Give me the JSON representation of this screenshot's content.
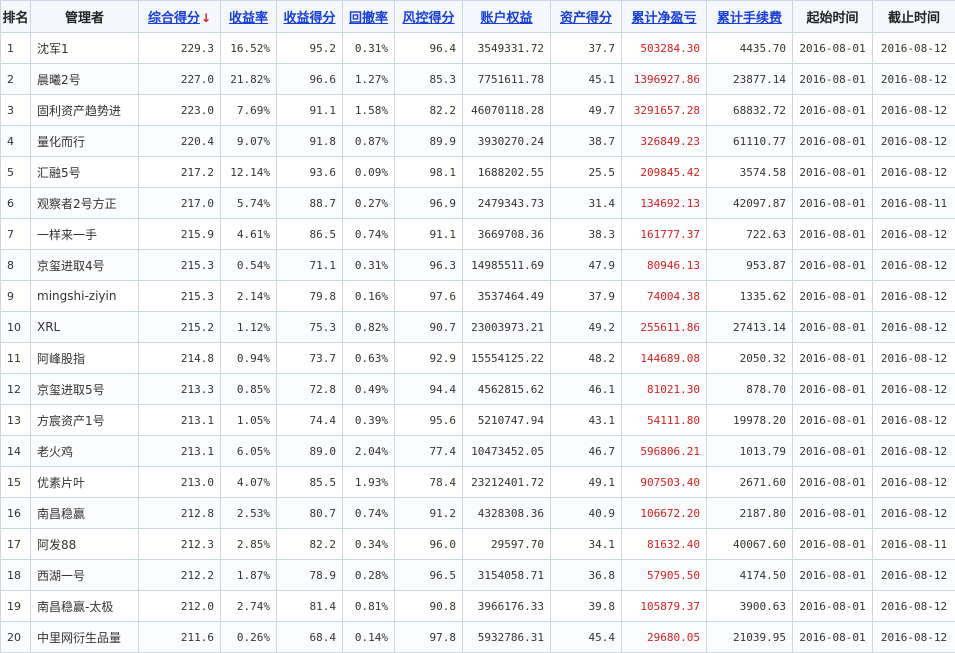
{
  "table": {
    "columns": [
      {
        "key": "rank",
        "label": "排名",
        "link": false
      },
      {
        "key": "manager",
        "label": "管理者",
        "link": false
      },
      {
        "key": "composite",
        "label": "综合得分",
        "link": true,
        "sorted": "desc",
        "sort_glyph": "↓"
      },
      {
        "key": "return_rate",
        "label": "收益率",
        "link": true
      },
      {
        "key": "return_score",
        "label": "收益得分",
        "link": true
      },
      {
        "key": "drawdown",
        "label": "回撤率",
        "link": true
      },
      {
        "key": "risk_score",
        "label": "风控得分",
        "link": true
      },
      {
        "key": "equity",
        "label": "账户权益",
        "link": true
      },
      {
        "key": "asset_score",
        "label": "资产得分",
        "link": true
      },
      {
        "key": "net_pnl",
        "label": "累计净盈亏",
        "link": true
      },
      {
        "key": "fees",
        "label": "累计手续费",
        "link": true
      },
      {
        "key": "start",
        "label": "起始时间",
        "link": false
      },
      {
        "key": "end",
        "label": "截止时间",
        "link": false
      }
    ],
    "rows": [
      [
        "1",
        "沈军1",
        "229.3",
        "16.52%",
        "95.2",
        "0.31%",
        "96.4",
        "3549331.72",
        "37.7",
        "503284.30",
        "4435.70",
        "2016-08-01",
        "2016-08-12"
      ],
      [
        "2",
        "晨曦2号",
        "227.0",
        "21.82%",
        "96.6",
        "1.27%",
        "85.3",
        "7751611.78",
        "45.1",
        "1396927.86",
        "23877.14",
        "2016-08-01",
        "2016-08-12"
      ],
      [
        "3",
        "固利资产趋势进",
        "223.0",
        "7.69%",
        "91.1",
        "1.58%",
        "82.2",
        "46070118.28",
        "49.7",
        "3291657.28",
        "68832.72",
        "2016-08-01",
        "2016-08-12"
      ],
      [
        "4",
        "量化而行",
        "220.4",
        "9.07%",
        "91.8",
        "0.87%",
        "89.9",
        "3930270.24",
        "38.7",
        "326849.23",
        "61110.77",
        "2016-08-01",
        "2016-08-12"
      ],
      [
        "5",
        "汇融5号",
        "217.2",
        "12.14%",
        "93.6",
        "0.09%",
        "98.1",
        "1688202.55",
        "25.5",
        "209845.42",
        "3574.58",
        "2016-08-01",
        "2016-08-12"
      ],
      [
        "6",
        "观察者2号方正",
        "217.0",
        "5.74%",
        "88.7",
        "0.27%",
        "96.9",
        "2479343.73",
        "31.4",
        "134692.13",
        "42097.87",
        "2016-08-01",
        "2016-08-11"
      ],
      [
        "7",
        "一样来一手",
        "215.9",
        "4.61%",
        "86.5",
        "0.74%",
        "91.1",
        "3669708.36",
        "38.3",
        "161777.37",
        "722.63",
        "2016-08-01",
        "2016-08-12"
      ],
      [
        "8",
        "京玺进取4号",
        "215.3",
        "0.54%",
        "71.1",
        "0.31%",
        "96.3",
        "14985511.69",
        "47.9",
        "80946.13",
        "953.87",
        "2016-08-01",
        "2016-08-12"
      ],
      [
        "9",
        "mingshi-ziyin",
        "215.3",
        "2.14%",
        "79.8",
        "0.16%",
        "97.6",
        "3537464.49",
        "37.9",
        "74004.38",
        "1335.62",
        "2016-08-01",
        "2016-08-12"
      ],
      [
        "10",
        "XRL",
        "215.2",
        "1.12%",
        "75.3",
        "0.82%",
        "90.7",
        "23003973.21",
        "49.2",
        "255611.86",
        "27413.14",
        "2016-08-01",
        "2016-08-12"
      ],
      [
        "11",
        "阿峰股指",
        "214.8",
        "0.94%",
        "73.7",
        "0.63%",
        "92.9",
        "15554125.22",
        "48.2",
        "144689.08",
        "2050.32",
        "2016-08-01",
        "2016-08-12"
      ],
      [
        "12",
        "京玺进取5号",
        "213.3",
        "0.85%",
        "72.8",
        "0.49%",
        "94.4",
        "4562815.62",
        "46.1",
        "81021.30",
        "878.70",
        "2016-08-01",
        "2016-08-12"
      ],
      [
        "13",
        "方宸资产1号",
        "213.1",
        "1.05%",
        "74.4",
        "0.39%",
        "95.6",
        "5210747.94",
        "43.1",
        "54111.80",
        "19978.20",
        "2016-08-01",
        "2016-08-12"
      ],
      [
        "14",
        "老火鸡",
        "213.1",
        "6.05%",
        "89.0",
        "2.04%",
        "77.4",
        "10473452.05",
        "46.7",
        "596806.21",
        "1013.79",
        "2016-08-01",
        "2016-08-12"
      ],
      [
        "15",
        "优素片叶",
        "213.0",
        "4.07%",
        "85.5",
        "1.93%",
        "78.4",
        "23212401.72",
        "49.1",
        "907503.40",
        "2671.60",
        "2016-08-01",
        "2016-08-12"
      ],
      [
        "16",
        "南昌稳赢",
        "212.8",
        "2.53%",
        "80.7",
        "0.74%",
        "91.2",
        "4328308.36",
        "40.9",
        "106672.20",
        "2187.80",
        "2016-08-01",
        "2016-08-12"
      ],
      [
        "17",
        "阿发88",
        "212.3",
        "2.85%",
        "82.2",
        "0.34%",
        "96.0",
        "29597.70",
        "34.1",
        "81632.40",
        "40067.60",
        "2016-08-01",
        "2016-08-11"
      ],
      [
        "18",
        "西湖一号",
        "212.2",
        "1.87%",
        "78.9",
        "0.28%",
        "96.5",
        "3154058.71",
        "36.8",
        "57905.50",
        "4174.50",
        "2016-08-01",
        "2016-08-12"
      ],
      [
        "19",
        "南昌稳赢-太极",
        "212.0",
        "2.74%",
        "81.4",
        "0.81%",
        "90.8",
        "3966176.33",
        "39.8",
        "105879.37",
        "3900.63",
        "2016-08-01",
        "2016-08-12"
      ],
      [
        "20",
        "中里网衍生品量",
        "211.6",
        "0.26%",
        "68.4",
        "0.14%",
        "97.8",
        "5932786.31",
        "45.4",
        "29680.05",
        "21039.95",
        "2016-08-01",
        "2016-08-12"
      ]
    ]
  },
  "colors": {
    "link": "#1a3fd6",
    "pnl": "#d81e1e",
    "sort_arrow": "#e01818",
    "border": "#cdd6e4"
  }
}
